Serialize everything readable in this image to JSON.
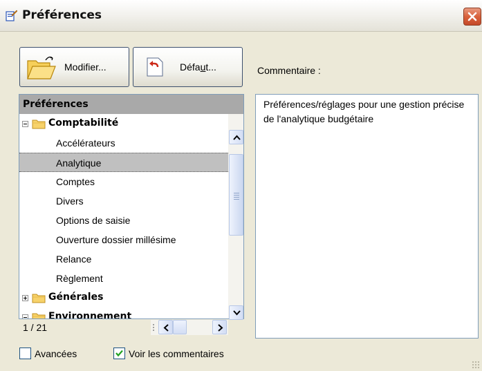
{
  "window": {
    "title": "Préférences",
    "close_icon": "close-icon"
  },
  "toolbar": {
    "modifier_label": "Modifier...",
    "defaut_label_pre": "Défa",
    "defaut_label_u": "u",
    "defaut_label_post": "t..."
  },
  "comment": {
    "label": "Commentaire :",
    "text": "Préférences/réglages pour une gestion précise de l'analytique budgétaire"
  },
  "tree": {
    "header": "Préférences",
    "items": [
      {
        "label": "Comptabilité",
        "level": 0,
        "expanded": true,
        "icon": "folder-icon"
      },
      {
        "label": "Accélérateurs",
        "level": 1
      },
      {
        "label": "Analytique",
        "level": 1,
        "selected": true
      },
      {
        "label": "Comptes",
        "level": 1
      },
      {
        "label": "Divers",
        "level": 1
      },
      {
        "label": "Options de saisie",
        "level": 1
      },
      {
        "label": "Ouverture dossier millésime",
        "level": 1
      },
      {
        "label": "Relance",
        "level": 1
      },
      {
        "label": "Règlement",
        "level": 1
      },
      {
        "label": "Générales",
        "level": 0,
        "expanded": false,
        "icon": "folder-icon"
      },
      {
        "label": "Environnement",
        "level": 0,
        "expanded": true,
        "icon": "folder-icon"
      }
    ],
    "page_count": "1 / 21"
  },
  "options": {
    "avancees_label": "Avancées",
    "avancees_checked": false,
    "voir_commentaires_label": "Voir les commentaires",
    "voir_commentaires_checked": true
  },
  "colors": {
    "selection": "#c0c0c0",
    "header": "#a9a9a9",
    "dialog_bg": "#ece9d8",
    "close_button": "#d9623c"
  }
}
